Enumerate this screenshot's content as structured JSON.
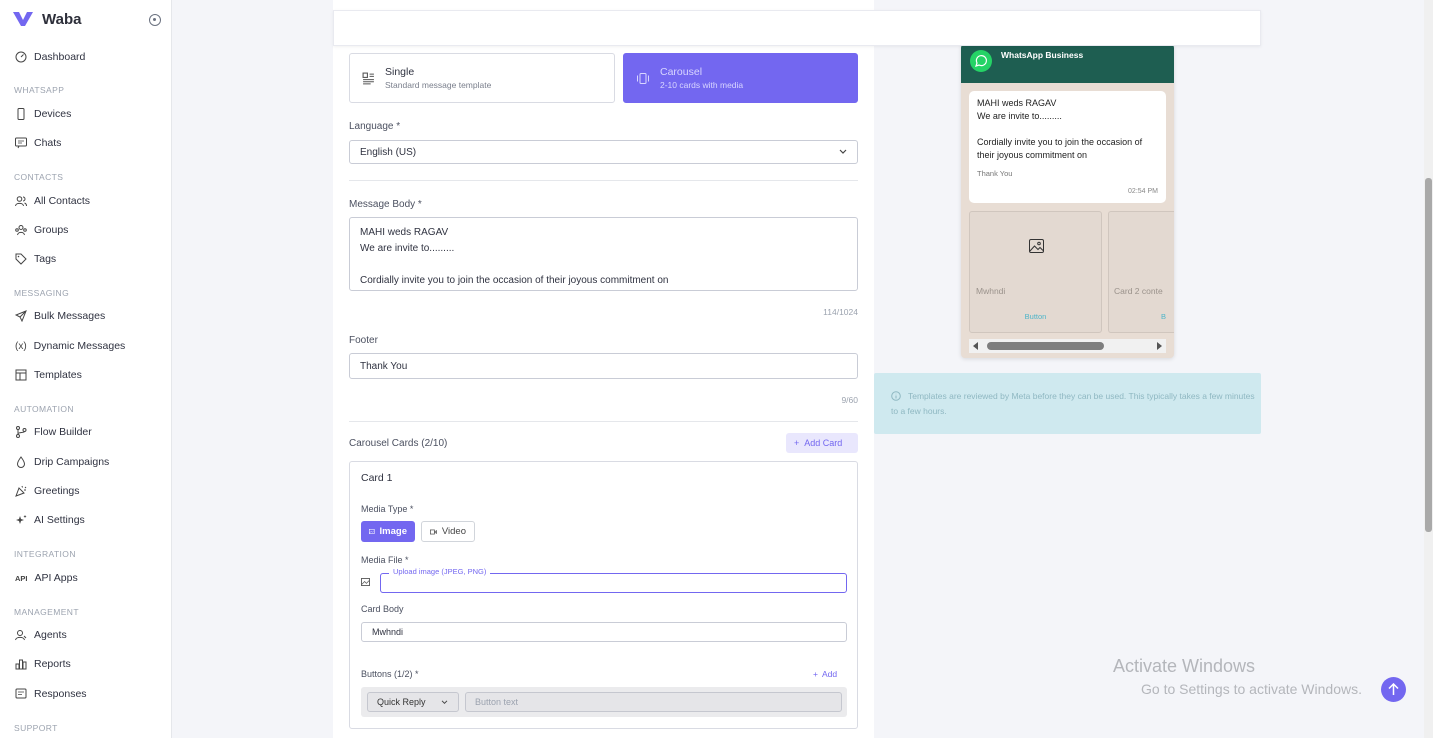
{
  "sidebar": {
    "brand": "Waba",
    "items": {
      "dashboard": "Dashboard",
      "devices": "Devices",
      "chats": "Chats",
      "all_contacts": "All Contacts",
      "groups": "Groups",
      "tags": "Tags",
      "bulk_messages": "Bulk Messages",
      "dynamic_messages": "Dynamic Messages",
      "templates": "Templates",
      "flow_builder": "Flow Builder",
      "drip_campaigns": "Drip Campaigns",
      "greetings": "Greetings",
      "ai_settings": "AI Settings",
      "api_apps": "API Apps",
      "agents": "Agents",
      "reports": "Reports",
      "responses": "Responses"
    },
    "sections": {
      "whatsapp": "WHATSAPP",
      "contacts": "CONTACTS",
      "messaging": "MESSAGING",
      "automation": "AUTOMATION",
      "integration": "INTEGRATION",
      "management": "MANAGEMENT",
      "support": "SUPPORT"
    },
    "dynamic_icon_text": "(x)",
    "api_icon_text": "API"
  },
  "form": {
    "single_title": "Single",
    "single_sub": "Standard message template",
    "carousel_title": "Carousel",
    "carousel_sub": "2-10 cards with media",
    "language_label": "Language *",
    "language_value": "English (US)",
    "body_label": "Message Body *",
    "body_line1": "MAHI weds RAGAV",
    "body_line2": "We are invite to.........",
    "body_line3": "Cordially invite you to join the occasion of their joyous commitment on",
    "body_counter": "114/1024",
    "footer_label": "Footer",
    "footer_value": "Thank You",
    "footer_counter": "9/60",
    "carousel_label": "Carousel Cards (2/10)",
    "add_card": "Add Card",
    "card_title": "Card 1",
    "media_type_label": "Media Type *",
    "image_btn": "Image",
    "video_btn": "Video",
    "media_file_label": "Media File *",
    "upload_label": "Upload image (JPEG, PNG)",
    "card_body_label": "Card Body",
    "card_body_value": "Mwhndi",
    "buttons_label": "Buttons (1/2) *",
    "add_button": "Add",
    "button_type": "Quick Reply",
    "button_text_placeholder": "Button text"
  },
  "preview": {
    "business_name": "WhatsApp Business",
    "msg_line1": "MAHI weds RAGAV",
    "msg_line2": "We are invite to.........",
    "msg_line3": "Cordially invite you to join the occasion of their joyous commitment on",
    "msg_footer": "Thank You",
    "msg_time": "02:54 PM",
    "card1_text": "Mwhndi",
    "card1_button": "Button",
    "card2_text": "Card 2 conte",
    "card2_button": "B",
    "notice": "Templates are reviewed by Meta before they can be used. This typically takes a few minutes to a few hours."
  },
  "watermark": {
    "line1": "Activate Windows",
    "line2": "Go to Settings to activate Windows."
  },
  "colors": {
    "accent": "#7367f0",
    "whatsapp_header": "#1e5e51",
    "whatsapp_green": "#25d366"
  }
}
